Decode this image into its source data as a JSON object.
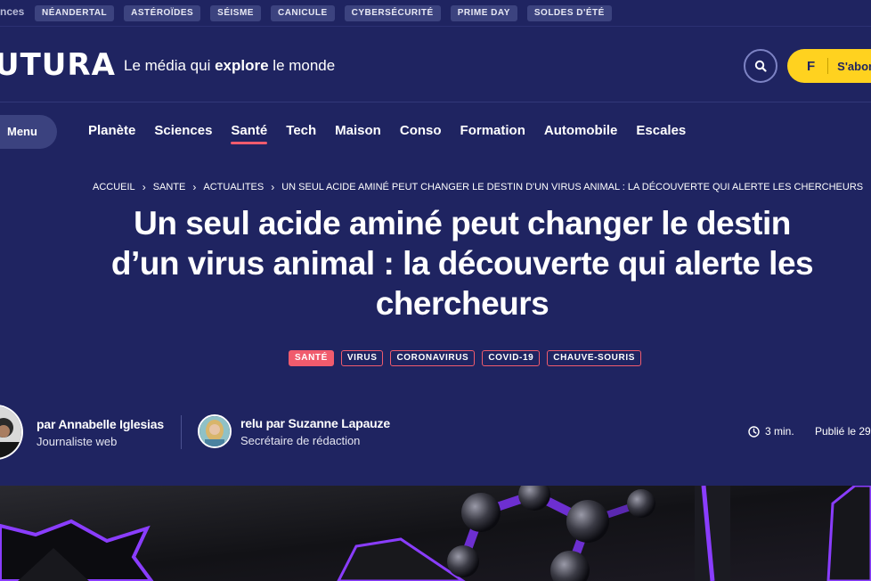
{
  "trending": {
    "label": "nces",
    "tags": [
      "NÉANDERTAL",
      "ASTÉROÏDES",
      "SÉISME",
      "CANICULE",
      "CYBERSÉCURITÉ",
      "PRIME DAY",
      "SOLDES D'ÉTÉ"
    ]
  },
  "header": {
    "logo": "UTURA",
    "tagline_pre": "Le média qui ",
    "tagline_bold": "explore",
    "tagline_post": " le monde",
    "search_icon": "search-icon",
    "subscribe_letter": "F",
    "subscribe_label": "S'abonner"
  },
  "nav": {
    "menu_label": "Menu",
    "items": [
      "Planète",
      "Sciences",
      "Santé",
      "Tech",
      "Maison",
      "Conso",
      "Formation",
      "Automobile",
      "Escales"
    ],
    "active": "Santé"
  },
  "breadcrumb": [
    "ACCUEIL",
    "SANTE",
    "ACTUALITES",
    "UN SEUL ACIDE AMINÉ PEUT CHANGER LE DESTIN D'UN VIRUS ANIMAL : LA DÉCOUVERTE QUI ALERTE LES CHERCHEURS"
  ],
  "article": {
    "title_line1": "Un seul acide aminé peut changer le destin",
    "title_line2": "d’un virus animal : la découverte qui alerte les",
    "title_line3": "chercheurs",
    "tags": [
      "SANTÉ",
      "VIRUS",
      "CORONAVIRUS",
      "COVID-19",
      "CHAUVE-SOURIS"
    ],
    "author": {
      "name": "par Annabelle Iglesias",
      "role": "Journaliste web"
    },
    "reviewer": {
      "name": "relu par Suzanne Lapauze",
      "role": "Secrétaire de rédaction"
    },
    "read_time": "3 min.",
    "published": "Publié le 29"
  },
  "colors": {
    "background": "#1f2461",
    "accent": "#f05b6d",
    "subscribe": "#ffd21f",
    "hero_purple": "#8a3dff"
  }
}
